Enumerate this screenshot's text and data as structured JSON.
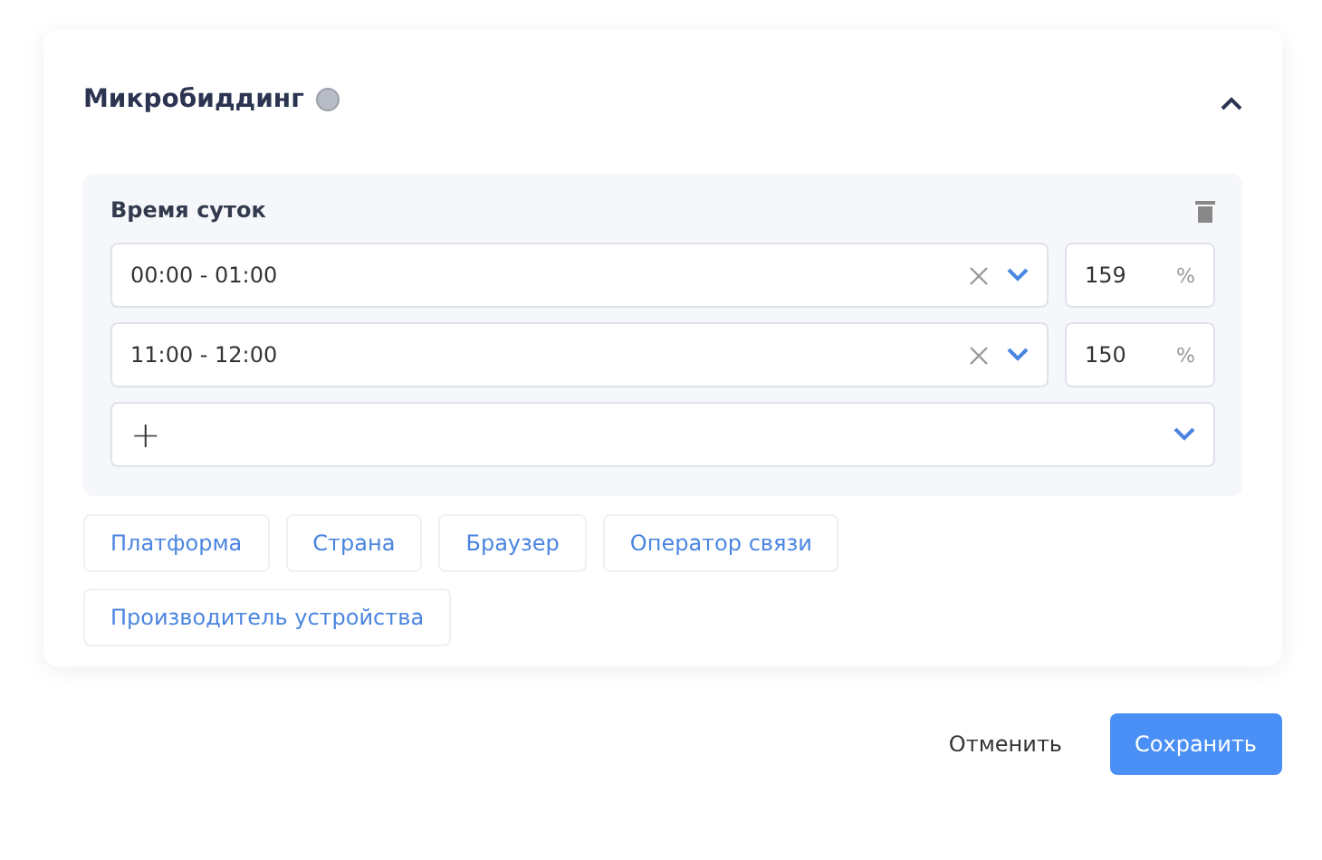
{
  "section": {
    "title": "Микробиддинг",
    "expanded": true
  },
  "group": {
    "title": "Время суток",
    "rows": [
      {
        "value": "00:00 - 01:00",
        "percent": "159",
        "unit": "%"
      },
      {
        "value": "11:00 - 12:00",
        "percent": "150",
        "unit": "%"
      }
    ],
    "add": "+"
  },
  "chips": [
    "Платформа",
    "Страна",
    "Браузер",
    "Оператор связи",
    "Производитель устройства"
  ],
  "buttons": {
    "cancel": "Отменить",
    "save": "Сохранить"
  }
}
